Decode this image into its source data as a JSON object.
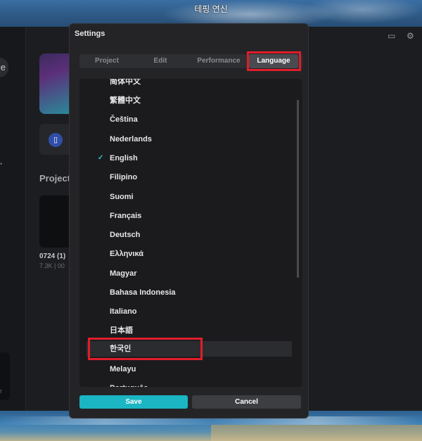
{
  "desktop": {
    "window_title": "테핑 연신"
  },
  "background_app": {
    "pill_text": "e",
    "projects_label": "Project",
    "project_name": "0724 (1)",
    "project_meta": "7.3K | 00",
    "left_thumb_text": "r"
  },
  "dialog": {
    "title": "Settings",
    "tabs": [
      {
        "label": "Project",
        "active": false
      },
      {
        "label": "Edit",
        "active": false
      },
      {
        "label": "Performance",
        "active": false
      },
      {
        "label": "Language",
        "active": true
      }
    ],
    "languages": [
      {
        "label": "简体中文",
        "selected": false
      },
      {
        "label": "繁體中文",
        "selected": false
      },
      {
        "label": "Čeština",
        "selected": false
      },
      {
        "label": "Nederlands",
        "selected": false
      },
      {
        "label": "English",
        "selected": true
      },
      {
        "label": "Filipino",
        "selected": false
      },
      {
        "label": "Suomi",
        "selected": false
      },
      {
        "label": "Français",
        "selected": false
      },
      {
        "label": "Deutsch",
        "selected": false
      },
      {
        "label": "Ελληνικά",
        "selected": false
      },
      {
        "label": "Magyar",
        "selected": false
      },
      {
        "label": "Bahasa Indonesia",
        "selected": false
      },
      {
        "label": "Italiano",
        "selected": false
      },
      {
        "label": "日本語",
        "selected": false
      },
      {
        "label": "한국인",
        "selected": false,
        "hovered": true
      },
      {
        "label": "Melayu",
        "selected": false
      },
      {
        "label": "Português",
        "selected": false
      }
    ],
    "check_glyph": "✓",
    "save_label": "Save",
    "cancel_label": "Cancel"
  },
  "colors": {
    "accent": "#1bb5c4",
    "check": "#2ec4c9",
    "annotation_red": "#e11d2a"
  }
}
